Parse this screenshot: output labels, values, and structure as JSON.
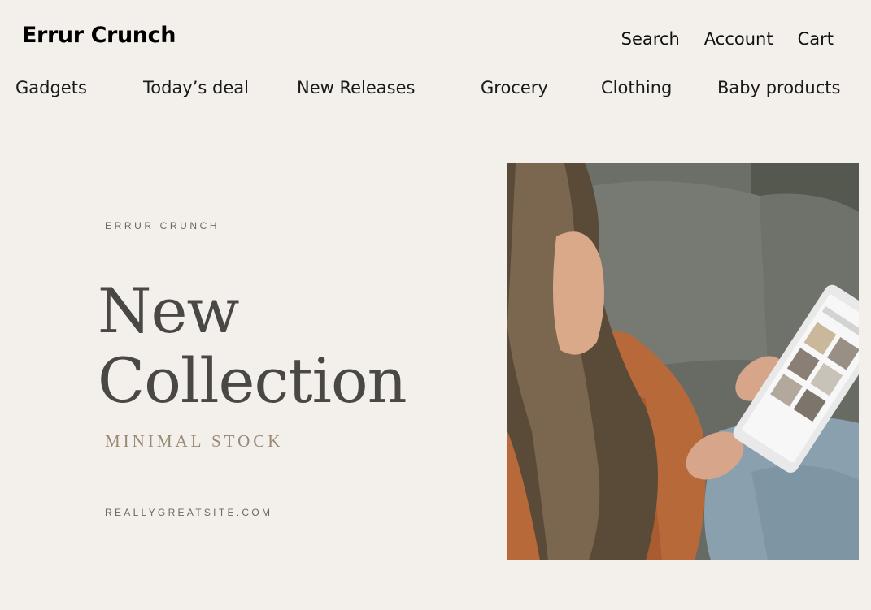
{
  "header": {
    "brand": "Errur Crunch",
    "nav": {
      "search": "Search",
      "account": "Account",
      "cart": "Cart"
    }
  },
  "categories": [
    "Gadgets",
    "Today’s deal",
    "New Releases",
    "Grocery",
    "Clothing",
    "Baby products"
  ],
  "hero": {
    "eyebrow": "ERRUR CRUNCH",
    "headline_line1": "New",
    "headline_line2": "Collection",
    "subline": "MINIMAL STOCK",
    "website": "REALLYGREATSITE.COM"
  },
  "colors": {
    "background": "#f3f0ec",
    "headline": "#4a4845",
    "accent": "#9b8a74",
    "muted": "#6b6762"
  }
}
